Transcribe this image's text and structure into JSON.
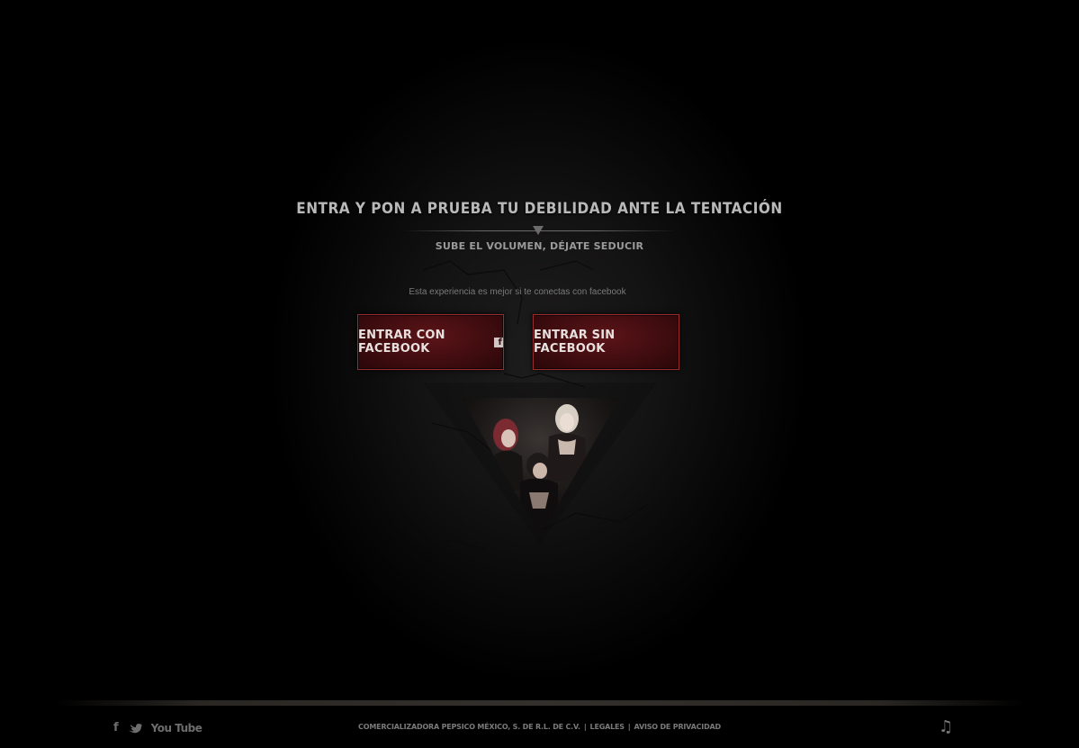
{
  "intro": {
    "headline": "ENTRA Y PON A PRUEBA TU DEBILIDAD ANTE LA TENTACIÓN",
    "subhead": "SUBE EL VOLUMEN, DÉJATE SEDUCIR",
    "note": "Esta experiencia es mejor si te conectas con facebook"
  },
  "buttons": {
    "facebook_label": "ENTRAR CON FACEBOOK",
    "facebook_glyph": "f",
    "no_facebook_label": "ENTRAR SIN FACEBOOK"
  },
  "footer": {
    "social": {
      "facebook_glyph": "f",
      "youtube_label": "You Tube"
    },
    "company": "COMERCIALIZADORA PEPSICO MÉXICO, S. DE R.L. DE C.V.",
    "separator": "|",
    "legales": "LEGALES",
    "privacy": "AVISO DE PRIVACIDAD",
    "music_glyph": "♫"
  },
  "colors": {
    "button_border": "#9a2b2f",
    "button_fill": "#3e0c0f",
    "text_light": "#b9b9b9"
  }
}
